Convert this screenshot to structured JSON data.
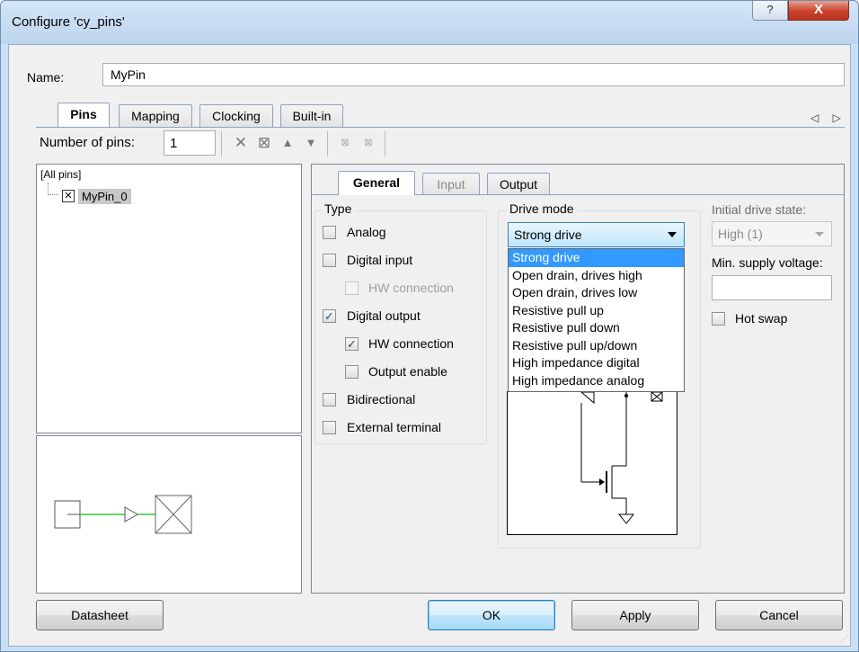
{
  "window": {
    "title": "Configure 'cy_pins'",
    "help_glyph": "?",
    "close_glyph": "X"
  },
  "name": {
    "label": "Name:",
    "value": "MyPin"
  },
  "tabs": [
    "Pins",
    "Mapping",
    "Clocking",
    "Built-in"
  ],
  "tab_nav": "◁ ▷",
  "pins": {
    "number_label": "Number of pins:",
    "number_value": "1",
    "toolbar_icons": [
      "delete-icon",
      "add-pin-icon",
      "move-up-icon",
      "move-down-icon",
      "split-icon",
      "merge-icon"
    ]
  },
  "tree": {
    "root": "[All pins]",
    "child": "MyPin_0"
  },
  "subtabs": [
    "General",
    "Input",
    "Output"
  ],
  "type_group": {
    "title": "Type",
    "analog": "Analog",
    "digital_input": "Digital input",
    "hw_connection_in": "HW connection",
    "digital_output": "Digital output",
    "hw_connection_out": "HW connection",
    "output_enable": "Output enable",
    "bidirectional": "Bidirectional",
    "external_terminal": "External terminal",
    "checked": [
      "digital_output",
      "hw_connection_out"
    ]
  },
  "drive": {
    "title": "Drive mode",
    "selected": "Strong drive",
    "options": [
      "Strong drive",
      "Open drain, drives high",
      "Open drain, drives low",
      "Resistive pull up",
      "Resistive pull down",
      "Resistive pull up/down",
      "High impedance digital",
      "High impedance analog"
    ]
  },
  "initial_drive": {
    "label": "Initial drive state:",
    "value": "High (1)"
  },
  "min_supply": {
    "label": "Min. supply voltage:",
    "value": ""
  },
  "hot_swap": {
    "label": "Hot swap",
    "checked": false
  },
  "buttons": {
    "datasheet": "Datasheet",
    "ok": "OK",
    "apply": "Apply",
    "cancel": "Cancel"
  },
  "colors": {
    "selection": "#3399ff",
    "title_bar": "#c9dff3",
    "close": "#c7412c",
    "wire": "#33cc33"
  }
}
